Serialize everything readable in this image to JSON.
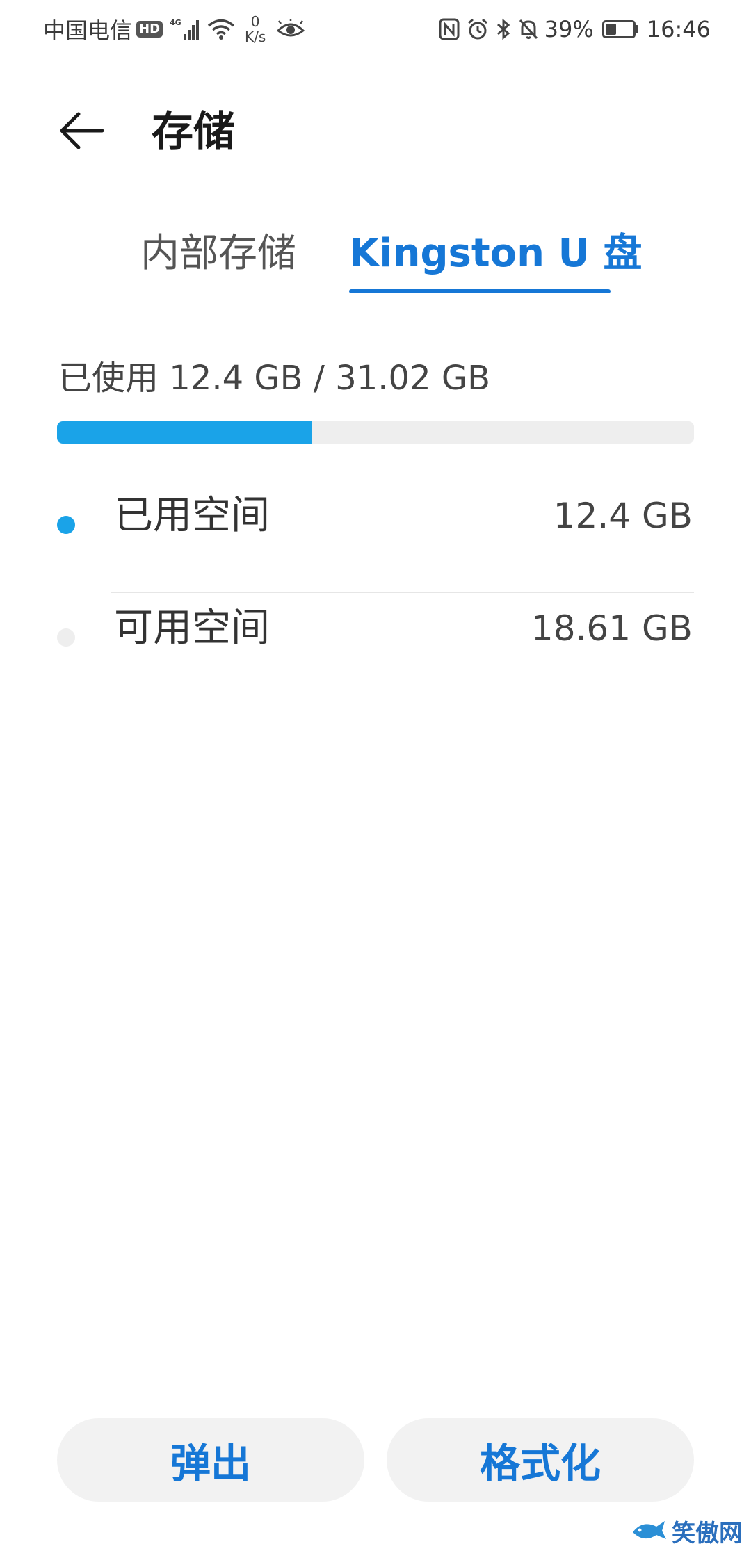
{
  "status_bar": {
    "carrier": "中国电信",
    "hd_badge": "HD",
    "network_type": "4G",
    "speed_value": "0",
    "speed_unit": "K/s",
    "battery_percent": "39%",
    "battery_level": 0.39,
    "time": "16:46",
    "icons": [
      "hd-icon",
      "signal-icon",
      "wifi-icon",
      "eye-icon",
      "nfc-icon",
      "alarm-icon",
      "bluetooth-icon",
      "mute-bell-icon",
      "battery-icon"
    ]
  },
  "app_bar": {
    "title": "存储",
    "back_icon": "back-arrow-icon"
  },
  "tabs": [
    {
      "label": "内部存储",
      "selected": false
    },
    {
      "label": "Kingston U 盘",
      "selected": true
    }
  ],
  "usage": {
    "summary": "已使用 12.4 GB / 31.02 GB",
    "used_fraction": 0.4
  },
  "legend": [
    {
      "label": "已用空间",
      "value": "12.4 GB",
      "color": "#1aa3e8"
    },
    {
      "label": "可用空间",
      "value": "18.61 GB",
      "color": "#eeeeee"
    }
  ],
  "actions": {
    "eject_label": "弹出",
    "format_label": "格式化"
  },
  "watermark": {
    "text": "笑傲网"
  },
  "colors": {
    "accent": "#1677d6",
    "used_bar": "#1aa3e8",
    "track": "#eeeeee",
    "button_bg": "#f2f2f2"
  }
}
